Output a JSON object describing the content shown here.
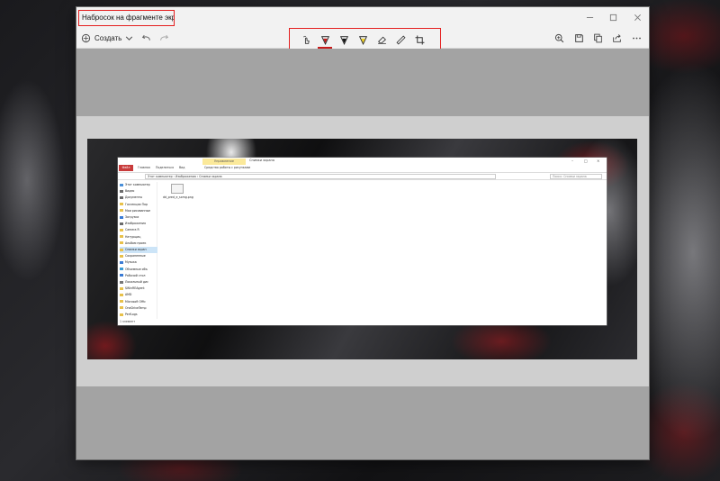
{
  "window": {
    "title": "Набросок на фрагменте экрана"
  },
  "toolbar": {
    "new_label": "Создать"
  },
  "explorer": {
    "ribbon_tag": "Управление",
    "title": "Снимки экрана",
    "tabs": [
      "Файл",
      "Главная",
      "Поделиться",
      "Вид",
      "Средства работы с рисунками"
    ],
    "address": "Этот компьютер › Изображения › Снимки экрана",
    "search_placeholder": "Поиск: Снимки экрана",
    "nav_items": [
      {
        "label": "Этот компьютер",
        "color": "#4a90d9"
      },
      {
        "label": "Видео",
        "color": "#6b6b6b"
      },
      {
        "label": "Документы",
        "color": "#6b6b6b"
      },
      {
        "label": "Госсекции Пар",
        "color": "#e8c14a"
      },
      {
        "label": "Мои рисованные",
        "color": "#e8c14a"
      },
      {
        "label": "Загрузки",
        "color": "#3a7bd5"
      },
      {
        "label": "Изображения",
        "color": "#6b6b6b"
      },
      {
        "label": "Camera R",
        "color": "#e8c14a"
      },
      {
        "label": "Натурщиц",
        "color": "#e8c14a"
      },
      {
        "label": "Альбом проек",
        "color": "#e8c14a"
      },
      {
        "label": "Снимки экран",
        "color": "#e8c14a"
      },
      {
        "label": "Сохраненные",
        "color": "#e8c14a"
      },
      {
        "label": "Музыка",
        "color": "#3a7bd5"
      },
      {
        "label": "Объемные объ",
        "color": "#3a9bd5"
      },
      {
        "label": "Рабочий стол",
        "color": "#3a7bd5"
      },
      {
        "label": "Локальный дис",
        "color": "#777777"
      },
      {
        "label": "$WinREAgent",
        "color": "#e8c14a"
      },
      {
        "label": "AMD",
        "color": "#e8c14a"
      },
      {
        "label": "Microsoft Offic",
        "color": "#e8c14a"
      },
      {
        "label": "OneDriveTemp",
        "color": "#e8c14a"
      },
      {
        "label": "PerfLogs",
        "color": "#e8c14a"
      }
    ],
    "file": {
      "name": "dd_pred_e_sxmg.png"
    },
    "status": "1 элемент"
  }
}
